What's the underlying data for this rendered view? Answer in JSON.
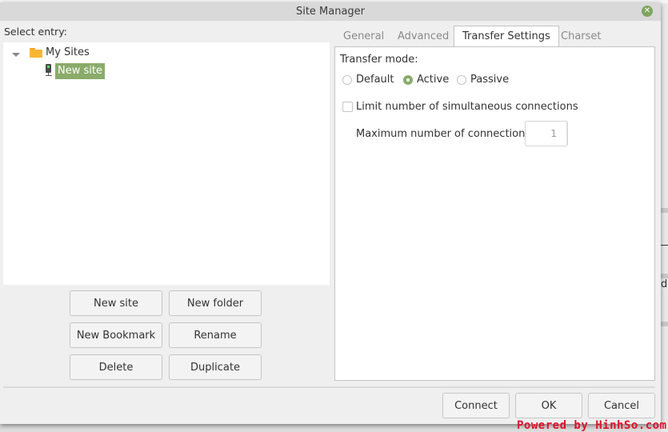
{
  "window": {
    "title": "Site Manager",
    "close_icon": "close-icon"
  },
  "left": {
    "select_label": "Select entry:",
    "tree": {
      "root": {
        "label": "My Sites",
        "icon": "folder-icon",
        "expanded": true
      },
      "children": [
        {
          "label": "New site",
          "icon": "server-icon",
          "selected": true
        }
      ]
    },
    "buttons": {
      "new_site": "New site",
      "new_folder": "New folder",
      "new_bookmark": "New Bookmark",
      "rename": "Rename",
      "delete": "Delete",
      "duplicate": "Duplicate"
    }
  },
  "tabs": [
    {
      "label": "General",
      "active": false
    },
    {
      "label": "Advanced",
      "active": false
    },
    {
      "label": "Transfer Settings",
      "active": true
    },
    {
      "label": "Charset",
      "active": false
    }
  ],
  "transfer": {
    "mode_label": "Transfer mode:",
    "modes": [
      {
        "label": "Default",
        "checked": false
      },
      {
        "label": "Active",
        "checked": true
      },
      {
        "label": "Passive",
        "checked": false
      }
    ],
    "limit_label": "Limit number of simultaneous connections",
    "limit_checked": false,
    "max_label": "Maximum number of connections:",
    "max_value": "1"
  },
  "footer": {
    "connect": "Connect",
    "ok": "OK",
    "cancel": "Cancel"
  },
  "background": {
    "partial_text": "di"
  },
  "watermark": "Powered by HinhSo.com",
  "colors": {
    "accent": "#8aab6a",
    "close_button": "#7ea660",
    "titlebar": "#d9d9d9",
    "dialog_bg": "#efefef"
  }
}
